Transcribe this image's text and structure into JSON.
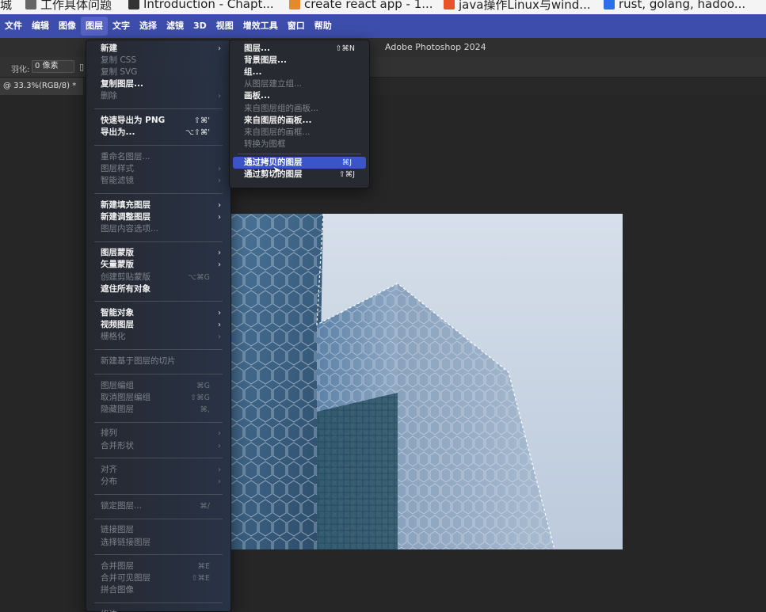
{
  "bookmarks": [
    {
      "text": "城",
      "color": ""
    },
    {
      "text": "工作具体问题",
      "color": "#666666"
    },
    {
      "text": "Introduction - Chapt...",
      "color": "#333333"
    },
    {
      "text": "create react app - 1...",
      "color": "#e58a2a"
    },
    {
      "text": "java操作Linux与wind...",
      "color": "#e8532a"
    },
    {
      "text": "rust, golang, hadoo...",
      "color": "#2a6ee8"
    }
  ],
  "menubar": {
    "items": [
      "文件",
      "编辑",
      "图像",
      "图层",
      "文字",
      "选择",
      "滤镜",
      "3D",
      "视图",
      "增效工具",
      "窗口",
      "帮助"
    ],
    "active": "图层",
    "accent": "#3d4dab"
  },
  "app": {
    "title": "Adobe Photoshop 2024"
  },
  "options": {
    "feather_label": "羽化:",
    "feather_value": "0 像素"
  },
  "document": {
    "tab": "@ 33.3%(RGB/8) *"
  },
  "layer_menu": {
    "items": [
      {
        "label": "新建",
        "shortcut": "",
        "submenu": true,
        "disabled": false
      },
      {
        "label": "复制 CSS",
        "shortcut": "",
        "submenu": false,
        "disabled": true
      },
      {
        "label": "复制 SVG",
        "shortcut": "",
        "submenu": false,
        "disabled": true
      },
      {
        "label": "复制图层...",
        "shortcut": "",
        "submenu": false,
        "disabled": false
      },
      {
        "label": "删除",
        "shortcut": "",
        "submenu": true,
        "disabled": true
      },
      {
        "sep": true
      },
      {
        "label": "快速导出为 PNG",
        "shortcut": "⇧⌘'",
        "submenu": false,
        "disabled": false
      },
      {
        "label": "导出为...",
        "shortcut": "⌥⇧⌘'",
        "submenu": false,
        "disabled": false
      },
      {
        "sep": true
      },
      {
        "label": "重命名图层...",
        "shortcut": "",
        "submenu": false,
        "disabled": true
      },
      {
        "label": "图层样式",
        "shortcut": "",
        "submenu": true,
        "disabled": true
      },
      {
        "label": "智能滤镜",
        "shortcut": "",
        "submenu": true,
        "disabled": true
      },
      {
        "sep": true
      },
      {
        "label": "新建填充图层",
        "shortcut": "",
        "submenu": true,
        "disabled": false
      },
      {
        "label": "新建调整图层",
        "shortcut": "",
        "submenu": true,
        "disabled": false
      },
      {
        "label": "图层内容选项...",
        "shortcut": "",
        "submenu": false,
        "disabled": true
      },
      {
        "sep": true
      },
      {
        "label": "图层蒙版",
        "shortcut": "",
        "submenu": true,
        "disabled": false
      },
      {
        "label": "矢量蒙版",
        "shortcut": "",
        "submenu": true,
        "disabled": false
      },
      {
        "label": "创建剪贴蒙版",
        "shortcut": "⌥⌘G",
        "submenu": false,
        "disabled": true
      },
      {
        "label": "遮住所有对象",
        "shortcut": "",
        "submenu": false,
        "disabled": false
      },
      {
        "sep": true
      },
      {
        "label": "智能对象",
        "shortcut": "",
        "submenu": true,
        "disabled": false
      },
      {
        "label": "视频图层",
        "shortcut": "",
        "submenu": true,
        "disabled": false
      },
      {
        "label": "栅格化",
        "shortcut": "",
        "submenu": true,
        "disabled": true
      },
      {
        "sep": true
      },
      {
        "label": "新建基于图层的切片",
        "shortcut": "",
        "submenu": false,
        "disabled": true
      },
      {
        "sep": true
      },
      {
        "label": "图层编组",
        "shortcut": "⌘G",
        "submenu": false,
        "disabled": true
      },
      {
        "label": "取消图层编组",
        "shortcut": "⇧⌘G",
        "submenu": false,
        "disabled": true
      },
      {
        "label": "隐藏图层",
        "shortcut": "⌘,",
        "submenu": false,
        "disabled": true
      },
      {
        "sep": true
      },
      {
        "label": "排列",
        "shortcut": "",
        "submenu": true,
        "disabled": true
      },
      {
        "label": "合并形状",
        "shortcut": "",
        "submenu": true,
        "disabled": true
      },
      {
        "sep": true
      },
      {
        "label": "对齐",
        "shortcut": "",
        "submenu": true,
        "disabled": true
      },
      {
        "label": "分布",
        "shortcut": "",
        "submenu": true,
        "disabled": true
      },
      {
        "sep": true
      },
      {
        "label": "锁定图层...",
        "shortcut": "⌘/",
        "submenu": false,
        "disabled": true
      },
      {
        "sep": true
      },
      {
        "label": "链接图层",
        "shortcut": "",
        "submenu": false,
        "disabled": true
      },
      {
        "label": "选择链接图层",
        "shortcut": "",
        "submenu": false,
        "disabled": true
      },
      {
        "sep": true
      },
      {
        "label": "合并图层",
        "shortcut": "⌘E",
        "submenu": false,
        "disabled": true
      },
      {
        "label": "合并可见图层",
        "shortcut": "⇧⌘E",
        "submenu": false,
        "disabled": true
      },
      {
        "label": "拼合图像",
        "shortcut": "",
        "submenu": false,
        "disabled": true
      },
      {
        "sep": true
      },
      {
        "label": "修边",
        "shortcut": "",
        "submenu": true,
        "disabled": true
      }
    ]
  },
  "new_submenu": {
    "items": [
      {
        "label": "图层...",
        "shortcut": "⇧⌘N",
        "disabled": false
      },
      {
        "label": "背景图层...",
        "shortcut": "",
        "disabled": false
      },
      {
        "label": "组...",
        "shortcut": "",
        "disabled": false
      },
      {
        "label": "从图层建立组...",
        "shortcut": "",
        "disabled": true
      },
      {
        "label": "画板...",
        "shortcut": "",
        "disabled": false
      },
      {
        "label": "来自图层组的画板...",
        "shortcut": "",
        "disabled": true
      },
      {
        "label": "来自图层的画板...",
        "shortcut": "",
        "disabled": false
      },
      {
        "label": "来自图层的画框...",
        "shortcut": "",
        "disabled": true
      },
      {
        "label": "转换为图框",
        "shortcut": "",
        "disabled": true
      },
      {
        "sep": true
      },
      {
        "label": "通过拷贝的图层",
        "shortcut": "⌘J",
        "disabled": false,
        "highlighted": true
      },
      {
        "label": "通过剪切的图层",
        "shortcut": "⇧⌘J",
        "disabled": false
      }
    ]
  }
}
